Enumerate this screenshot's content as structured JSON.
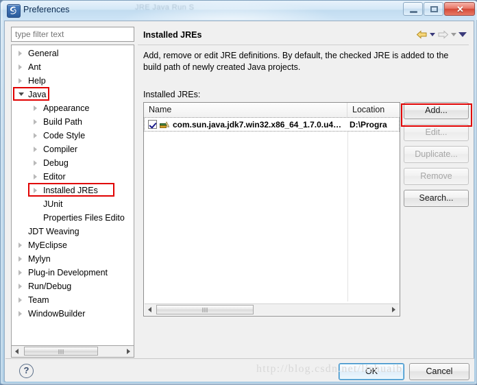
{
  "window": {
    "title": "Preferences",
    "icon": "eclipse-icon",
    "ghost_title": "JRE                 Java   Run   S",
    "controls": {
      "minimize": "minimize-button",
      "maximize": "maximize-button",
      "close_glyph": "✕"
    }
  },
  "left": {
    "filter_placeholder": "type filter text",
    "filter_value": "",
    "tree": [
      {
        "label": "General",
        "indent": 0,
        "state": "collapsed",
        "highlight": false
      },
      {
        "label": "Ant",
        "indent": 0,
        "state": "collapsed",
        "highlight": false
      },
      {
        "label": "Help",
        "indent": 0,
        "state": "collapsed",
        "highlight": false
      },
      {
        "label": "Java",
        "indent": 0,
        "state": "expanded",
        "highlight": true
      },
      {
        "label": "Appearance",
        "indent": 1,
        "state": "collapsed",
        "highlight": false
      },
      {
        "label": "Build Path",
        "indent": 1,
        "state": "collapsed",
        "highlight": false
      },
      {
        "label": "Code Style",
        "indent": 1,
        "state": "collapsed",
        "highlight": false
      },
      {
        "label": "Compiler",
        "indent": 1,
        "state": "collapsed",
        "highlight": false
      },
      {
        "label": "Debug",
        "indent": 1,
        "state": "collapsed",
        "highlight": false
      },
      {
        "label": "Editor",
        "indent": 1,
        "state": "collapsed",
        "highlight": false
      },
      {
        "label": "Installed JREs",
        "indent": 1,
        "state": "collapsed",
        "highlight": true
      },
      {
        "label": "JUnit",
        "indent": 1,
        "state": "none",
        "highlight": false
      },
      {
        "label": "Properties Files Edito",
        "indent": 1,
        "state": "none",
        "highlight": false
      },
      {
        "label": "JDT Weaving",
        "indent": 0,
        "state": "none",
        "highlight": false
      },
      {
        "label": "MyEclipse",
        "indent": 0,
        "state": "collapsed",
        "highlight": false
      },
      {
        "label": "Mylyn",
        "indent": 0,
        "state": "collapsed",
        "highlight": false
      },
      {
        "label": "Plug-in Development",
        "indent": 0,
        "state": "collapsed",
        "highlight": false
      },
      {
        "label": "Run/Debug",
        "indent": 0,
        "state": "collapsed",
        "highlight": false
      },
      {
        "label": "Team",
        "indent": 0,
        "state": "collapsed",
        "highlight": false
      },
      {
        "label": "WindowBuilder",
        "indent": 0,
        "state": "collapsed",
        "highlight": false
      }
    ]
  },
  "right": {
    "page_title": "Installed JREs",
    "description": "Add, remove or edit JRE definitions. By default, the checked JRE is added to the build path of newly created Java projects.",
    "table_label": "Installed JREs:",
    "nav": {
      "back": "back-arrow-icon",
      "forward": "forward-arrow-icon"
    },
    "table": {
      "columns": [
        "Name",
        "Location"
      ],
      "rows": [
        {
          "checked": true,
          "name": "com.sun.java.jdk7.win32.x86_64_1.7.0.u4…",
          "location": "D:\\Progra"
        }
      ]
    },
    "buttons": [
      {
        "label": "Add...",
        "accel": "A",
        "enabled": true,
        "highlight": true
      },
      {
        "label": "Edit...",
        "accel": "E",
        "enabled": false,
        "highlight": false
      },
      {
        "label": "Duplicate...",
        "accel": "c",
        "enabled": false,
        "highlight": false
      },
      {
        "label": "Remove",
        "accel": "R",
        "enabled": false,
        "highlight": false
      },
      {
        "label": "Search...",
        "accel": "S",
        "enabled": true,
        "highlight": false
      }
    ]
  },
  "footer": {
    "help": "?",
    "ok": "OK",
    "cancel": "Cancel"
  },
  "watermark": "http://blog.csdn.net/lishuaib",
  "colors": {
    "accent": "#e00000",
    "default_button_border": "#3c8cc4",
    "titlebar": "#cde4f6"
  }
}
